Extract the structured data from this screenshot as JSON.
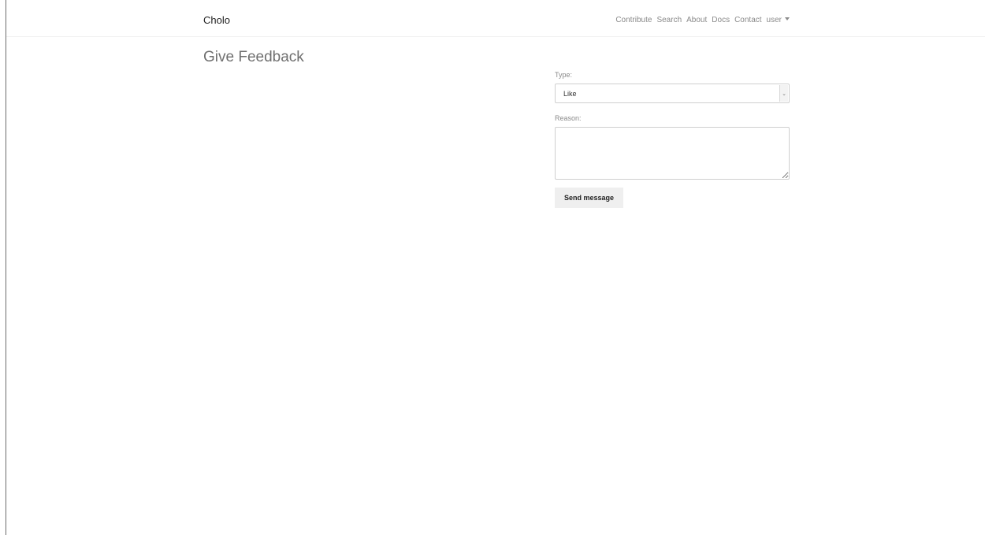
{
  "navbar": {
    "brand": "Cholo",
    "links": [
      "Contribute",
      "Search",
      "About",
      "Docs",
      "Contact"
    ],
    "user_menu": "user"
  },
  "page": {
    "title": "Give Feedback"
  },
  "form": {
    "type_label": "Type:",
    "type_value": "Like",
    "reason_label": "Reason:",
    "reason_value": "",
    "submit_label": "Send message"
  },
  "icons": {
    "select_arrow": "chevron-down-icon",
    "user_caret": "caret-down-icon"
  }
}
